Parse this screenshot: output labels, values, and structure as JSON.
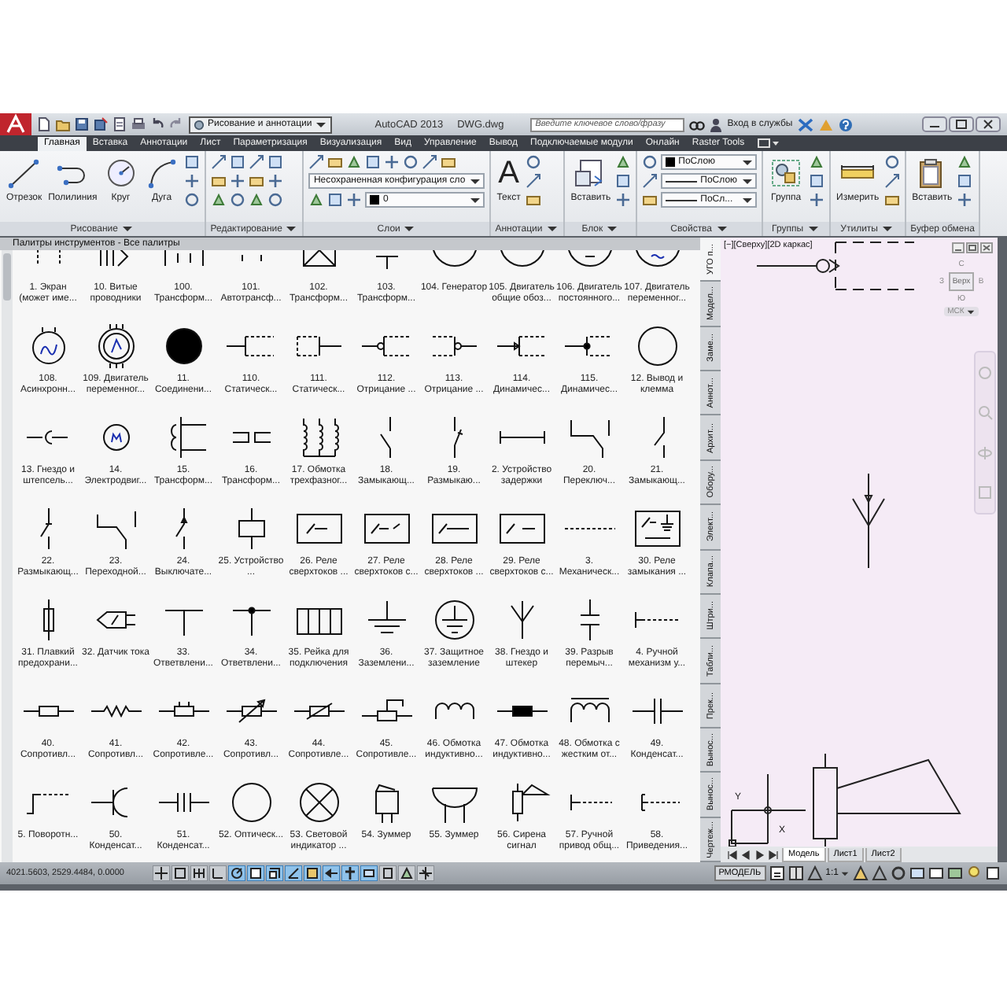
{
  "title_bar": {
    "workspace": "Рисование и аннотации",
    "app_title": "AutoCAD 2013",
    "file_name": "DWG.dwg",
    "search": {
      "placeholder": "Введите ключевое слово/фразу"
    },
    "sign_in": "Вход в службы"
  },
  "ribbon_tabs": [
    {
      "label": "Главная",
      "selected": true
    },
    {
      "label": "Вставка",
      "selected": false
    },
    {
      "label": "Аннотации",
      "selected": false
    },
    {
      "label": "Лист",
      "selected": false
    },
    {
      "label": "Параметризация",
      "selected": false
    },
    {
      "label": "Визуализация",
      "selected": false
    },
    {
      "label": "Вид",
      "selected": false
    },
    {
      "label": "Управление",
      "selected": false
    },
    {
      "label": "Вывод",
      "selected": false
    },
    {
      "label": "Подключаемые модули",
      "selected": false
    },
    {
      "label": "Онлайн",
      "selected": false
    },
    {
      "label": "Raster Tools",
      "selected": false
    }
  ],
  "ribbon_groups": [
    {
      "label": "Рисование",
      "caret": true,
      "columns": [
        [
          [
            {
              "kind": "large",
              "label": "Отрезок"
            }
          ]
        ],
        [
          [
            {
              "kind": "large",
              "label": "Полилиния"
            }
          ]
        ],
        [
          [
            {
              "kind": "large",
              "label": "Круг"
            }
          ]
        ],
        [
          [
            {
              "kind": "large",
              "label": "Дуга"
            }
          ]
        ],
        [
          [
            {
              "kind": "small"
            }
          ],
          [
            {
              "kind": "small"
            }
          ],
          [
            {
              "kind": "small"
            }
          ]
        ]
      ]
    },
    {
      "label": "Редактирование",
      "caret": true,
      "columns": [
        [
          [
            {
              "kind": "small"
            }
          ],
          [
            {
              "kind": "small"
            }
          ],
          [
            {
              "kind": "small"
            }
          ]
        ],
        [
          [
            {
              "kind": "small"
            }
          ],
          [
            {
              "kind": "small"
            }
          ],
          [
            {
              "kind": "small"
            }
          ]
        ],
        [
          [
            {
              "kind": "small"
            }
          ],
          [
            {
              "kind": "small"
            }
          ],
          [
            {
              "kind": "small"
            }
          ]
        ],
        [
          [
            {
              "kind": "small"
            }
          ],
          [
            {
              "kind": "small"
            }
          ],
          [
            {
              "kind": "small"
            }
          ]
        ]
      ]
    },
    {
      "label": "Слои",
      "caret": true,
      "columns": [
        [
          [
            {
              "kind": "small"
            },
            {
              "kind": "small"
            },
            {
              "kind": "small"
            },
            {
              "kind": "small"
            },
            {
              "kind": "small"
            },
            {
              "kind": "small"
            },
            {
              "kind": "small"
            },
            {
              "kind": "small"
            }
          ],
          [
            {
              "kind": "combo",
              "label": "Несохраненная конфигурация сло"
            }
          ],
          [
            {
              "kind": "small"
            },
            {
              "kind": "small"
            },
            {
              "kind": "small"
            },
            {
              "kind": "combo",
              "label": "0",
              "swatch": true
            }
          ]
        ]
      ]
    },
    {
      "label": "Аннотации",
      "caret": true,
      "columns": [
        [
          [
            {
              "kind": "large",
              "glyph": "A",
              "label": "Текст"
            }
          ]
        ],
        [
          [
            {
              "kind": "small"
            }
          ],
          [
            {
              "kind": "small"
            }
          ],
          [
            {
              "kind": "small"
            }
          ]
        ]
      ]
    },
    {
      "label": "Блок",
      "caret": true,
      "columns": [
        [
          [
            {
              "kind": "large",
              "label": "Вставить"
            }
          ]
        ],
        [
          [
            {
              "kind": "small"
            }
          ],
          [
            {
              "kind": "small"
            }
          ],
          [
            {
              "kind": "small"
            }
          ]
        ]
      ]
    },
    {
      "label": "Свойства",
      "caret": true,
      "columns": [
        [
          [
            {
              "kind": "small"
            },
            {
              "kind": "combo",
              "label": "ПоСлою",
              "swatch": true
            }
          ],
          [
            {
              "kind": "small"
            },
            {
              "kind": "combo",
              "label": "ПоСлою",
              "linetype": true
            }
          ],
          [
            {
              "kind": "small"
            },
            {
              "kind": "combo",
              "label": "ПоСл...",
              "linetype": true
            }
          ]
        ]
      ]
    },
    {
      "label": "Группы",
      "caret": true,
      "columns": [
        [
          [
            {
              "kind": "large",
              "label": "Группа"
            }
          ]
        ],
        [
          [
            {
              "kind": "small"
            }
          ],
          [
            {
              "kind": "small"
            }
          ],
          [
            {
              "kind": "small"
            }
          ]
        ]
      ]
    },
    {
      "label": "Утилиты",
      "caret": true,
      "columns": [
        [
          [
            {
              "kind": "large",
              "label": "Измерить"
            }
          ]
        ],
        [
          [
            {
              "kind": "small"
            }
          ],
          [
            {
              "kind": "small"
            }
          ],
          [
            {
              "kind": "small"
            }
          ]
        ]
      ]
    },
    {
      "label": "Буфер обмена",
      "caret": false,
      "columns": [
        [
          [
            {
              "kind": "large",
              "label": "Вставить"
            }
          ]
        ],
        [
          [
            {
              "kind": "small"
            }
          ],
          [
            {
              "kind": "small"
            }
          ],
          [
            {
              "kind": "small"
            }
          ]
        ]
      ]
    }
  ],
  "tool_palette": {
    "title": "Палитры инструментов - Все палитры",
    "tools": [
      {
        "label": "1. Экран (может име..."
      },
      {
        "label": "10. Витые проводники"
      },
      {
        "label": "100. Трансформ..."
      },
      {
        "label": "101. Автотрансф..."
      },
      {
        "label": "102. Трансформ..."
      },
      {
        "label": "103. Трансформ..."
      },
      {
        "label": "104. Генератор"
      },
      {
        "label": "105. Двигатель общие обоз..."
      },
      {
        "label": "106. Двигатель постоянного..."
      },
      {
        "label": "107. Двигатель переменног..."
      },
      {
        "label": "108. Асинхронн..."
      },
      {
        "label": "109. Двигатель переменног..."
      },
      {
        "label": "11. Соединени..."
      },
      {
        "label": "110. Статическ..."
      },
      {
        "label": "111. Статическ..."
      },
      {
        "label": "112. Отрицание ..."
      },
      {
        "label": "113. Отрицание ..."
      },
      {
        "label": "114. Динамичес..."
      },
      {
        "label": "115. Динамичес..."
      },
      {
        "label": "12. Вывод и клемма"
      },
      {
        "label": "13. Гнездо и штепсель..."
      },
      {
        "label": "14. Электродвиг..."
      },
      {
        "label": "15. Трансформ..."
      },
      {
        "label": "16. Трансформ..."
      },
      {
        "label": "17. Обмотка трехфазног..."
      },
      {
        "label": "18. Замыкающ..."
      },
      {
        "label": "19. Размыкаю..."
      },
      {
        "label": "2. Устройство задержки"
      },
      {
        "label": "20. Переключ..."
      },
      {
        "label": "21. Замыкающ..."
      },
      {
        "label": "22. Размыкающ..."
      },
      {
        "label": "23. Переходной..."
      },
      {
        "label": "24. Выключате..."
      },
      {
        "label": "25. Устройство ..."
      },
      {
        "label": "26. Реле сверхтоков ..."
      },
      {
        "label": "27. Реле сверхтоков с..."
      },
      {
        "label": "28. Реле сверхтоков ..."
      },
      {
        "label": "29. Реле сверхтоков с..."
      },
      {
        "label": "3. Механическ..."
      },
      {
        "label": "30. Реле замыкания ..."
      },
      {
        "label": "31. Плавкий предохрани..."
      },
      {
        "label": "32. Датчик тока"
      },
      {
        "label": "33. Ответвлени..."
      },
      {
        "label": "34. Ответвлени..."
      },
      {
        "label": "35. Рейка для подключения"
      },
      {
        "label": "36. Заземлени..."
      },
      {
        "label": "37. Защитное заземление"
      },
      {
        "label": "38. Гнездо и штекер"
      },
      {
        "label": "39. Разрыв перемыч..."
      },
      {
        "label": "4. Ручной механизм у..."
      },
      {
        "label": "40. Сопротивл..."
      },
      {
        "label": "41. Сопротивл..."
      },
      {
        "label": "42. Сопротивле..."
      },
      {
        "label": "43. Сопротивл..."
      },
      {
        "label": "44. Сопротивле..."
      },
      {
        "label": "45. Сопротивле..."
      },
      {
        "label": "46. Обмотка индуктивно..."
      },
      {
        "label": "47. Обмотка индуктивно..."
      },
      {
        "label": "48. Обмотка с жестким от..."
      },
      {
        "label": "49. Конденсат..."
      },
      {
        "label": "5. Поворотн..."
      },
      {
        "label": "50. Конденсат..."
      },
      {
        "label": "51. Конденсат..."
      },
      {
        "label": "52. Оптическ..."
      },
      {
        "label": "53. Световой индикатор ..."
      },
      {
        "label": "54. Зуммер"
      },
      {
        "label": "55. Зуммер"
      },
      {
        "label": "56. Сирена сигнал"
      },
      {
        "label": "57. Ручной привод общ..."
      },
      {
        "label": "58. Приведения..."
      }
    ],
    "side_tabs": [
      {
        "label": "УГО п...",
        "selected": true
      },
      {
        "label": "Модел...",
        "selected": false
      },
      {
        "label": "Заме...",
        "selected": false
      },
      {
        "label": "Аннот...",
        "selected": false
      },
      {
        "label": "Архит...",
        "selected": false
      },
      {
        "label": "Обору...",
        "selected": false
      },
      {
        "label": "Элект...",
        "selected": false
      },
      {
        "label": "Клапа...",
        "selected": false
      },
      {
        "label": "Штри...",
        "selected": false
      },
      {
        "label": "Табли...",
        "selected": false
      },
      {
        "label": "Прек...",
        "selected": false
      },
      {
        "label": "Вынос...",
        "selected": false
      },
      {
        "label": "Вынос...",
        "selected": false
      },
      {
        "label": "Чертеж...",
        "selected": false
      }
    ]
  },
  "viewport": {
    "label": "[−][Сверху][2D каркас]",
    "viewcube": {
      "north": "С",
      "west": "З",
      "top": "Верх",
      "east": "В",
      "south": "Ю",
      "ucs_menu": "МСК"
    },
    "ucs": {
      "y_label": "Y",
      "x_label": "X"
    },
    "layout_tabs": [
      {
        "label": "Модель",
        "selected": true
      },
      {
        "label": "Лист1",
        "selected": false
      },
      {
        "label": "Лист2",
        "selected": false
      }
    ]
  },
  "status_bar": {
    "coordinates": "4021.5603, 2529.4484, 0.0000",
    "toggles": [
      {
        "on": false
      },
      {
        "on": false
      },
      {
        "on": false
      },
      {
        "on": false
      },
      {
        "on": true
      },
      {
        "on": true
      },
      {
        "on": true
      },
      {
        "on": true
      },
      {
        "on": true
      },
      {
        "on": true
      },
      {
        "on": true
      },
      {
        "on": true
      },
      {
        "on": false
      },
      {
        "on": false
      },
      {
        "on": false
      }
    ],
    "space": "РМОДЕЛЬ",
    "scale": "1:1"
  }
}
